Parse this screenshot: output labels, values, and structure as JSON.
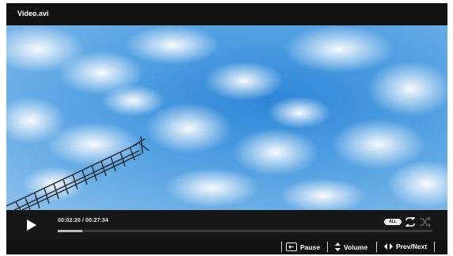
{
  "window": {
    "title": "Video.avi"
  },
  "player": {
    "time_display": "00:02:20 / 00:27:34",
    "progress_fraction": 0.065,
    "repeat_mode_label": "ALL"
  },
  "hints": {
    "pause_label": "Pause",
    "volume_label": "Volume",
    "prevnext_label": "Prev/Next"
  },
  "icons": [
    "play-icon",
    "repeat-icon",
    "shuffle-icon",
    "pause-key-icon",
    "volume-updown-icon",
    "left-right-arrows-icon"
  ],
  "colors": {
    "sky": "#4a9be0",
    "bar_bg": "#101010",
    "progress_fill": "#bdbdbd"
  }
}
